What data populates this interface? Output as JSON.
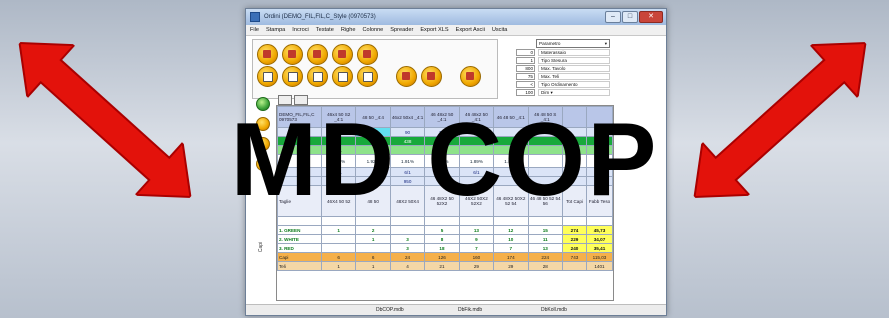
{
  "overlay": {
    "title": "MD COP"
  },
  "window": {
    "title": "Ordini (DEMO_FIL,FIL,C_Style (0970573)",
    "menu": [
      "File",
      "Stampa",
      "Incroci",
      "Testate",
      "Righe",
      "Colonne",
      "Spreader",
      "Export XLS",
      "Export Ascii",
      "Uscita"
    ],
    "params": {
      "select_label": "Parametro",
      "rows": [
        {
          "value": "0",
          "label": "Materassaio"
        },
        {
          "value": "1",
          "label": "Tipo Stesura"
        },
        {
          "value": "800",
          "label": "Max. Tavolo"
        },
        {
          "value": "75",
          "label": "Max. Teli"
        },
        {
          "value": "<",
          "label": "Tipo Ordinamento"
        },
        {
          "value": "100",
          "label": "Dim ▾"
        }
      ]
    },
    "side_label": "Capi",
    "table": {
      "header": [
        "DEMO_FIL,FIL,C 0970573",
        "46x4 50 S2 _4:1",
        "48 50 _4:4",
        "46x2 50x4 _4:1",
        "46 48x2 50 _4:1",
        "46 48x2 50 _4:1",
        "46 48 50 _4:1",
        "46 48 50 S _4:1",
        "",
        ""
      ],
      "blue_row": [
        "",
        "",
        "",
        "90",
        "95",
        "",
        "",
        "",
        "",
        ""
      ],
      "green_row": [
        "",
        "",
        "",
        "438",
        "300",
        "",
        "",
        "",
        "",
        ""
      ],
      "lgreen_row": [
        "",
        "1 1",
        "",
        "",
        "",
        "",
        "3",
        "",
        "",
        ""
      ],
      "pct_row": [
        "",
        "1.92%",
        "1.92%",
        "1.91%",
        "1.93%",
        "1.89%",
        "1.89%",
        "",
        "",
        ""
      ],
      "row_a": [
        "",
        "6/1",
        "",
        "6/1",
        "6/1",
        "6/1",
        "",
        "",
        "",
        ""
      ],
      "row_b": [
        "",
        "",
        "900",
        "950",
        "950",
        "",
        "",
        "",
        "",
        ""
      ],
      "size_row": [
        "Taglie",
        "46X4 50 52",
        "48 50",
        "48X2 50X4",
        "46 48X2 50 52X2",
        "46X2 50X2 52X2",
        "46 48X2 50X2 52 54",
        "46 48 50 52 54 56",
        "Tot Capi",
        "Fabb Teso"
      ],
      "qty_rows": [
        {
          "label": "1. GREEN",
          "cells": [
            "1",
            "2",
            "",
            "5",
            "13",
            "12",
            "15"
          ],
          "tot": "274",
          "fabb": "45,73"
        },
        {
          "label": "2. WHITE",
          "cells": [
            "",
            "1",
            "3",
            "8",
            "9",
            "10",
            "11"
          ],
          "tot": "229",
          "fabb": "34,07"
        },
        {
          "label": "3. RED",
          "cells": [
            "",
            "",
            "3",
            "18",
            "7",
            "7",
            "13"
          ],
          "tot": "240",
          "fabb": "35,41"
        }
      ],
      "orange_row": {
        "label": "Capi",
        "cells": [
          "6",
          "6",
          "24",
          "126",
          "160",
          "174",
          "224"
        ],
        "tot": "743",
        "fabb": "115,03"
      },
      "pink_row": {
        "label": "Teli",
        "cells": [
          "1",
          "1",
          "4",
          "21",
          "29",
          "29",
          "28"
        ],
        "tot": "",
        "fabb": "1401"
      }
    },
    "status": [
      "DbCOP.mdb",
      "DbFik.mdb",
      "DbKoll.mdb"
    ]
  }
}
